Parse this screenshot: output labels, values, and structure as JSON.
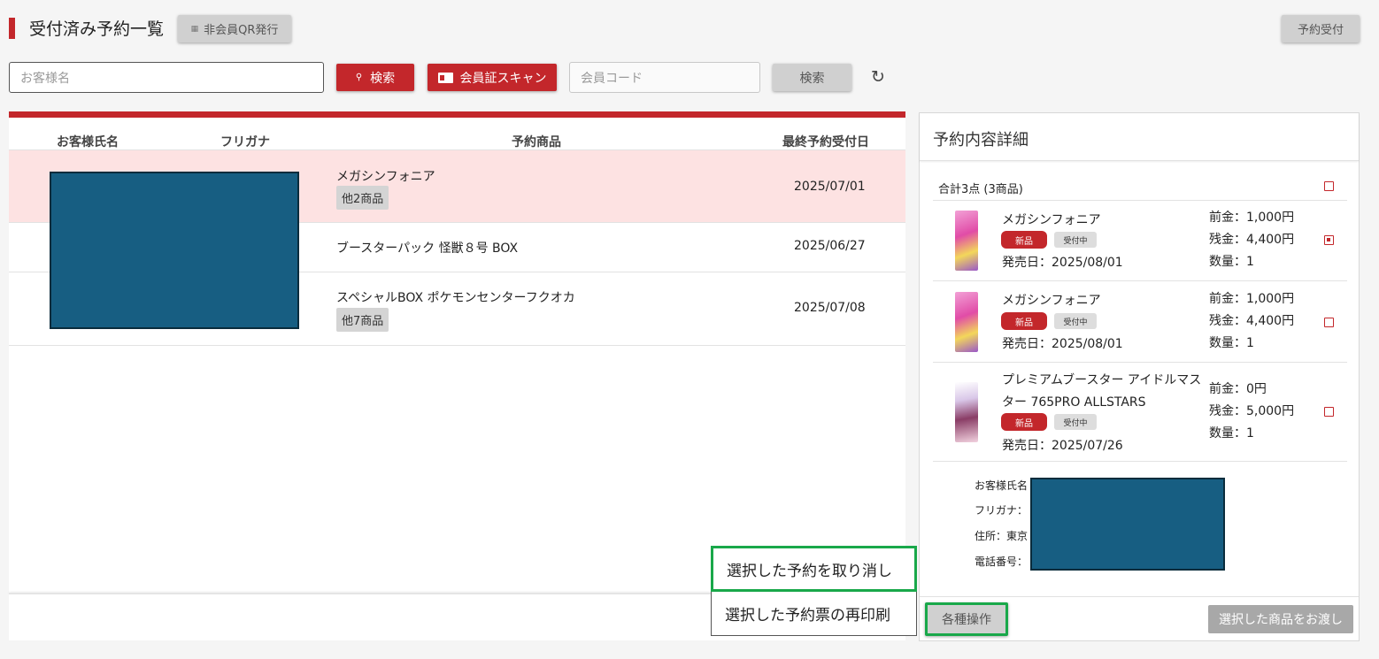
{
  "header": {
    "title": "受付済み予約一覧",
    "qr_button": "非会員QR発行",
    "reserve_button": "予約受付"
  },
  "search": {
    "name_placeholder": "お客様名",
    "search_label": "検索",
    "scan_label": "会員証スキャン",
    "code_placeholder": "会員コード",
    "code_search_label": "検索"
  },
  "table": {
    "headers": [
      "お客様氏名",
      "フリガナ",
      "予約商品",
      "最終予約受付日"
    ],
    "rows": [
      {
        "product": "メガシンフォニア",
        "extra": "他2商品",
        "date": "2025/07/01"
      },
      {
        "product": "ブースターパック 怪獣８号 BOX",
        "extra": "",
        "date": "2025/06/27"
      },
      {
        "product": "スペシャルBOX ポケモンセンターフクオカ",
        "extra": "他7商品",
        "date": "2025/07/08"
      }
    ]
  },
  "detail": {
    "title": "予約内容詳細",
    "summary": "合計3点 (3商品)",
    "items": [
      {
        "name": "メガシンフォニア",
        "name2": "",
        "badge_new": "新品",
        "badge_status": "受付中",
        "release": "発売日：2025/08/01",
        "deposit": "前金：1,000円",
        "balance": "残金：4,400円",
        "qty": "数量：1",
        "checked": true
      },
      {
        "name": "メガシンフォニア",
        "name2": "",
        "badge_new": "新品",
        "badge_status": "受付中",
        "release": "発売日：2025/08/01",
        "deposit": "前金：1,000円",
        "balance": "残金：4,400円",
        "qty": "数量：1",
        "checked": false
      },
      {
        "name": "プレミアムブースター アイドルマス",
        "name2": "ター 765PRO ALLSTARS",
        "badge_new": "新品",
        "badge_status": "受付中",
        "release": "発売日：2025/07/26",
        "deposit": "前金：0円",
        "balance": "残金：5,000円",
        "qty": "数量：1",
        "checked": false
      }
    ],
    "customer": {
      "name_label": "お客様氏名",
      "kana_label": "フリガナ：",
      "address_label": "住所：東京",
      "phone_label": "電話番号："
    },
    "ops_button": "各種操作",
    "deliver_button": "選択した商品をお渡し"
  },
  "menu": {
    "items": [
      "選択した予約を取り消し",
      "選択した予約票の再印刷"
    ]
  },
  "colors": {
    "accent": "#c3272b",
    "selected_row": "#fde2e2",
    "highlight": "#19a84a",
    "redaction": "#175e82"
  }
}
